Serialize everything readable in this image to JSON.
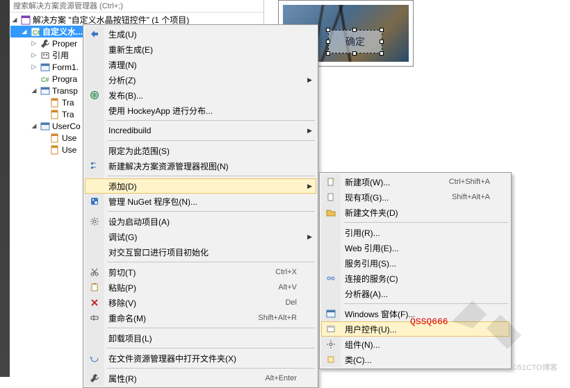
{
  "watermark": "©51CTO博客",
  "annotate": "QSSQ666",
  "solution_explorer": {
    "search_hint": "搜索解决方案资源管理器 (Ctrl+;)",
    "root": "解决方案 \"自定义水晶按钮控件\" (1 个项目)",
    "project": "自定义水...",
    "nodes": {
      "props": "Proper",
      "refs": "引用",
      "form1": "Form1.",
      "program": "Progra",
      "transp": "Transp",
      "tra1": "Tra",
      "tra2": "Tra",
      "usercon": "UserCo",
      "use1": "Use",
      "use2": "Use"
    }
  },
  "designer": {
    "button_text": "确定"
  },
  "menu1": {
    "build": "生成(U)",
    "rebuild": "重新生成(E)",
    "clean": "清理(N)",
    "analyze": "分析(Z)",
    "publish": "发布(B)...",
    "hockey": "使用 HockeyApp 进行分布...",
    "incred": "Incredibuild",
    "scope": "限定为此范围(S)",
    "newview": "新建解决方案资源管理器视图(N)",
    "add": "添加(D)",
    "nuget": "管理 NuGet 程序包(N)...",
    "startup": "设为启动项目(A)",
    "debug": "调试(G)",
    "interact": "对交互窗口进行项目初始化",
    "cut": "剪切(T)",
    "paste": "粘贴(P)",
    "remove": "移除(V)",
    "rename": "重命名(M)",
    "unload": "卸载项目(L)",
    "openfolder": "在文件资源管理器中打开文件夹(X)",
    "props2": "属性(R)",
    "sc_cut": "Ctrl+X",
    "sc_paste": "Alt+V",
    "sc_del": "Del",
    "sc_rename": "Shift+Alt+R",
    "sc_props": "Alt+Enter"
  },
  "menu2": {
    "newitem": "新建项(W)...",
    "existing": "现有项(G)...",
    "newfolder": "新建文件夹(D)",
    "ref": "引用(R)...",
    "webref": "Web 引用(E)...",
    "svcref": "服务引用(S)...",
    "connsvc": "连接的服务(C)",
    "analyzer": "分析器(A)...",
    "winform": "Windows 窗体(F)...",
    "userctrl": "用户控件(U)...",
    "component": "组件(N)...",
    "class": "类(C)...",
    "sc_new": "Ctrl+Shift+A",
    "sc_exist": "Shift+Alt+A"
  }
}
